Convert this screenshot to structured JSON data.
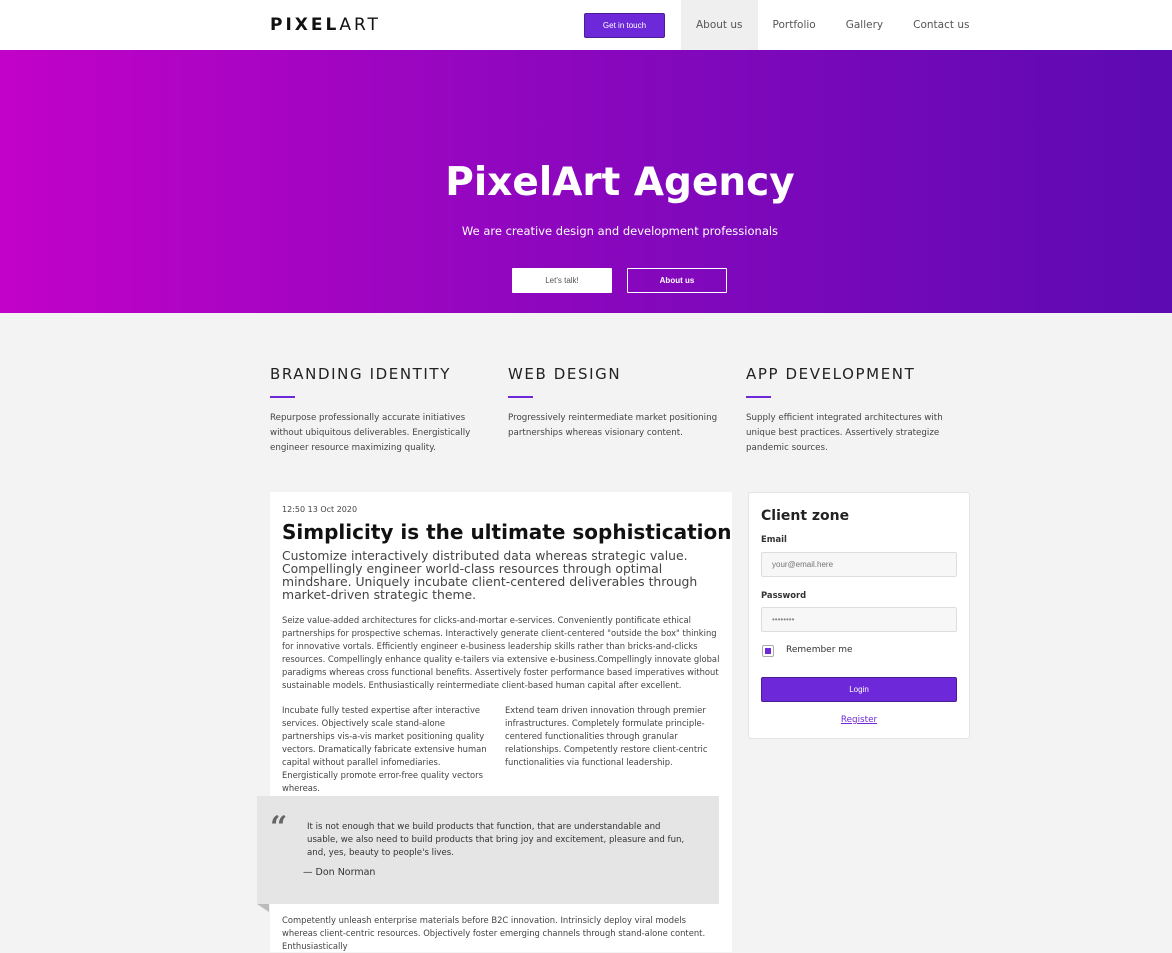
{
  "header": {
    "logo_bold": "PIXEL",
    "logo_light": "ART",
    "cta": "Get in touch",
    "nav": [
      "About us",
      "Portfolio",
      "Gallery",
      "Contact us"
    ]
  },
  "hero": {
    "title": "PixelArt Agency",
    "subtitle": "We are creative design and development professionals",
    "btn_primary": "Let's talk!",
    "btn_secondary": "About us"
  },
  "services": [
    {
      "title": "BRANDING IDENTITY",
      "text": "Repurpose professionally accurate initiatives without ubiquitous deliverables. Energistically engineer resource maximizing quality."
    },
    {
      "title": "WEB DESIGN",
      "text": "Progressively reintermediate market positioning partnerships whereas visionary content."
    },
    {
      "title": "APP DEVELOPMENT",
      "text": "Supply efficient integrated architectures with unique best practices. Assertively strategize pandemic sources."
    }
  ],
  "article": {
    "timestamp": "12:50 13 Oct 2020",
    "title": "Simplicity is the ultimate sophistication",
    "lead": "Customize interactively distributed data whereas strategic value. Compellingly engineer world-class resources through optimal mindshare. Uniquely incubate client-centered deliverables through market-driven strategic theme.",
    "body": "Seize value-added architectures for clicks-and-mortar e-services. Conveniently pontificate ethical partnerships for prospective schemas. Interactively generate client-centered \"outside the box\" thinking for innovative vortals. Efficiently engineer e-business leadership skills rather than bricks-and-clicks resources. Compellingly enhance quality e-tailers via extensive e-business.Compellingly innovate global paradigms whereas cross functional benefits. Assertively foster performance based imperatives without sustainable models. Enthusiastically reintermediate client-based human capital after excellent.",
    "col1": "Incubate fully tested expertise after interactive services. Objectively scale stand-alone partnerships vis-a-vis market positioning quality vectors. Dramatically fabricate extensive human capital without parallel infomediaries. Energistically promote error-free quality vectors whereas.",
    "col2": "Extend team driven innovation through premier infrastructures. Completely formulate principle-centered functionalities through granular relationships. Competently restore client-centric functionalities via functional leadership.",
    "quote_mark": "“",
    "quote": "It is not enough that we build products that function, that are understandable and usable, we also need to build products that bring joy and excitement, pleasure and fun, and, yes, beauty to people's lives.",
    "quote_author": "— Don Norman",
    "bottom": "Competently unleash enterprise materials before B2C innovation. Intrinsicly deploy viral models whereas client-centric resources. Objectively foster emerging channels through stand-alone content. Enthusiastically"
  },
  "client_zone": {
    "title": "Client zone",
    "email_label": "Email",
    "email_placeholder": "your@email.here",
    "password_label": "Password",
    "password_value": "••••••••",
    "remember": "Remember me",
    "login": "Login",
    "register": "Register"
  },
  "colors": {
    "accent": "#6d28d9",
    "hero_start": "#c202c8",
    "hero_end": "#5c0ab2"
  }
}
